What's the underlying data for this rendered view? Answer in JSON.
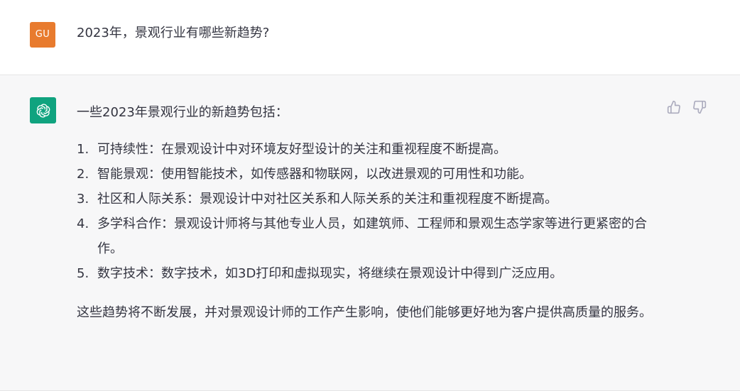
{
  "user": {
    "avatar_initials": "GU",
    "message": "2023年，景观行业有哪些新趋势?"
  },
  "assistant": {
    "avatar_icon": "openai-logo-icon",
    "intro": "一些2023年景观行业的新趋势包括：",
    "items": [
      {
        "num": "1.",
        "text": "可持续性：在景观设计中对环境友好型设计的关注和重视程度不断提高。"
      },
      {
        "num": "2.",
        "text": "智能景观：使用智能技术，如传感器和物联网，以改进景观的可用性和功能。"
      },
      {
        "num": "3.",
        "text": "社区和人际关系：景观设计中对社区关系和人际关系的关注和重视程度不断提高。"
      },
      {
        "num": "4.",
        "text": "多学科合作：景观设计师将与其他专业人员，如建筑师、工程师和景观生态学家等进行更紧密的合作。"
      },
      {
        "num": "5.",
        "text": "数字技术：数字技术，如3D打印和虚拟现实，将继续在景观设计中得到广泛应用。"
      }
    ],
    "outro": "这些趋势将不断发展，并对景观设计师的工作产生影响，使他们能够更好地为客户提供高质量的服务。"
  },
  "feedback": {
    "thumbs_up_icon": "thumbs-up-icon",
    "thumbs_down_icon": "thumbs-down-icon"
  },
  "colors": {
    "user_avatar_bg": "#e87b2e",
    "bot_avatar_bg": "#10a37f",
    "bot_row_bg": "#f7f7f8",
    "text": "#343541"
  }
}
